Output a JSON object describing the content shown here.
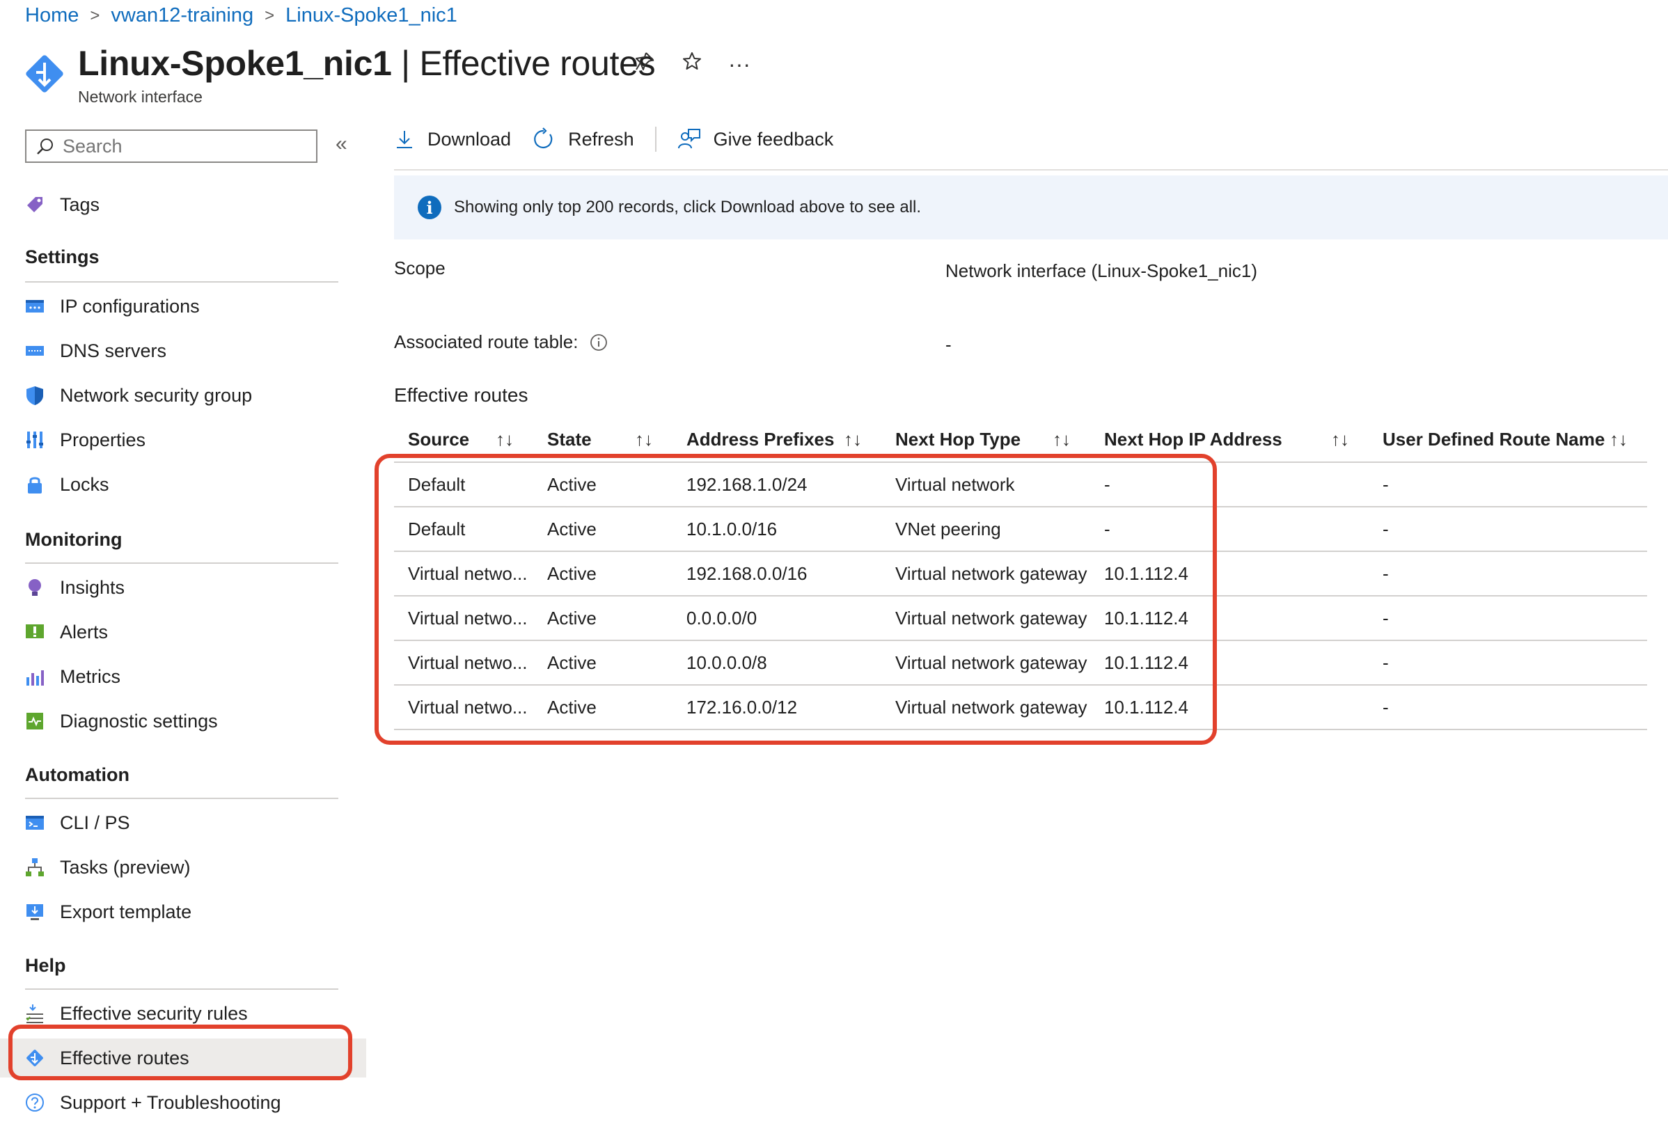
{
  "breadcrumb": [
    "Home",
    "vwan12-training",
    "Linux-Spoke1_nic1"
  ],
  "header": {
    "resource_name": "Linux-Spoke1_nic1",
    "title_suffix": " | Effective routes",
    "subtitle": "Network interface",
    "more_label": "···"
  },
  "sidebar": {
    "search_placeholder": "Search",
    "collapse_label": "«",
    "top_items": [
      {
        "label": "Tags",
        "icon": "tag-icon"
      }
    ],
    "sections": [
      {
        "title": "Settings",
        "items": [
          {
            "label": "IP configurations",
            "icon": "ip-config-icon"
          },
          {
            "label": "DNS servers",
            "icon": "dns-icon"
          },
          {
            "label": "Network security group",
            "icon": "shield-icon"
          },
          {
            "label": "Properties",
            "icon": "properties-icon"
          },
          {
            "label": "Locks",
            "icon": "lock-icon"
          }
        ]
      },
      {
        "title": "Monitoring",
        "items": [
          {
            "label": "Insights",
            "icon": "lightbulb-icon"
          },
          {
            "label": "Alerts",
            "icon": "alert-icon"
          },
          {
            "label": "Metrics",
            "icon": "metrics-icon"
          },
          {
            "label": "Diagnostic settings",
            "icon": "diagnostic-icon"
          }
        ]
      },
      {
        "title": "Automation",
        "items": [
          {
            "label": "CLI / PS",
            "icon": "terminal-icon"
          },
          {
            "label": "Tasks (preview)",
            "icon": "tasks-icon"
          },
          {
            "label": "Export template",
            "icon": "export-icon"
          }
        ]
      },
      {
        "title": "Help",
        "items": [
          {
            "label": "Effective security rules",
            "icon": "security-rules-icon"
          },
          {
            "label": "Effective routes",
            "icon": "routes-icon",
            "selected": true
          },
          {
            "label": "Support + Troubleshooting",
            "icon": "help-icon"
          }
        ]
      }
    ]
  },
  "toolbar": {
    "download_label": "Download",
    "refresh_label": "Refresh",
    "feedback_label": "Give feedback"
  },
  "info_message": "Showing only top 200 records, click Download above to see all.",
  "scope": {
    "label": "Scope",
    "value": "Network interface (Linux-Spoke1_nic1)"
  },
  "route_table": {
    "label": "Associated route table:",
    "value": "-"
  },
  "routes_section_title": "Effective routes",
  "table": {
    "sort_glyph": "↑↓",
    "columns": [
      "Source",
      "State",
      "Address Prefixes",
      "Next Hop Type",
      "Next Hop IP Address",
      "User Defined Route Name"
    ],
    "rows": [
      [
        "Default",
        "Active",
        "192.168.1.0/24",
        "Virtual network",
        "-",
        "-"
      ],
      [
        "Default",
        "Active",
        "10.1.0.0/16",
        "VNet peering",
        "-",
        "-"
      ],
      [
        "Virtual netwo...",
        "Active",
        "192.168.0.0/16",
        "Virtual network gateway",
        "10.1.112.4",
        "-"
      ],
      [
        "Virtual netwo...",
        "Active",
        "0.0.0.0/0",
        "Virtual network gateway",
        "10.1.112.4",
        "-"
      ],
      [
        "Virtual netwo...",
        "Active",
        "10.0.0.0/8",
        "Virtual network gateway",
        "10.1.112.4",
        "-"
      ],
      [
        "Virtual netwo...",
        "Active",
        "172.16.0.0/12",
        "Virtual network gateway",
        "10.1.112.4",
        "-"
      ]
    ]
  },
  "colors": {
    "accent": "#0f6cbd",
    "highlight": "#e2412c",
    "info_bg": "#eff4fb",
    "selected_bg": "#edebe9"
  }
}
